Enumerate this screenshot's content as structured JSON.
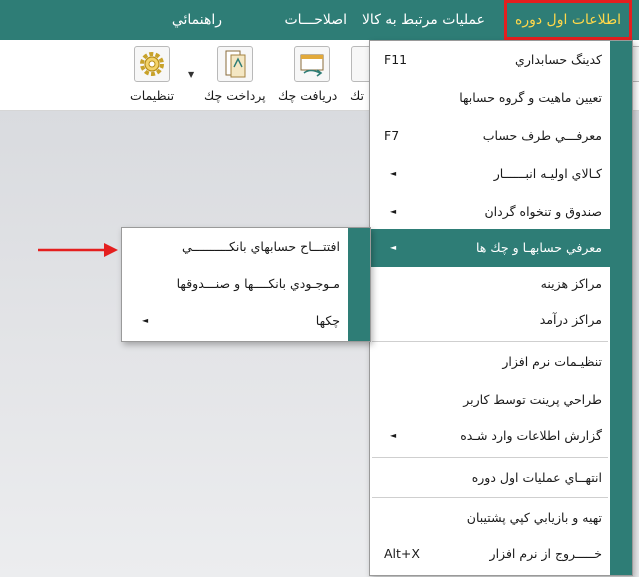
{
  "menubar": {
    "items": [
      {
        "label": "اطلاعات اول دوره",
        "active": true
      },
      {
        "label": "عمليات مرتبط به کالا"
      },
      {
        "label": "اصلاحـــات"
      },
      {
        "label": "راهنمائي"
      }
    ]
  },
  "toolbar": {
    "buttons": [
      {
        "label": "تنظيمات",
        "icon": "gear-icon"
      },
      {
        "label": "پرداخت چك",
        "icon": "check-payment-icon"
      },
      {
        "label": "دريافت چك",
        "icon": "check-receive-icon"
      },
      {
        "label": "تك",
        "icon": "partial-icon"
      }
    ]
  },
  "main_menu": {
    "items": [
      {
        "label": "كدينگ حسابداري",
        "shortcut": "F11"
      },
      {
        "label": "تعيين ماهيت و گروه حسابها"
      },
      {
        "label": "معرفـــي طرف حساب",
        "shortcut": "F7"
      },
      {
        "label": "كـالاي اوليـه انبــــــار"
      },
      {
        "label": "صندوق و تنخواه گردان"
      },
      {
        "label": "معرفي حسابهـا و چك ها"
      },
      {
        "label": "مراكز هزينه"
      },
      {
        "label": "مراكز درآمد"
      },
      {
        "label": "تنظيـمات نرم افزار"
      },
      {
        "label": "طراحي پرينت توسط كاربر"
      },
      {
        "label": "گزارش اطلاعات وارد شـده"
      },
      {
        "label": "انتهــاي عمليات اول دوره"
      },
      {
        "label": "تهيه و بازيابي كپي پشتيبان"
      },
      {
        "label": "خـــــروج از نرم افزار",
        "shortcut": "Alt+X"
      }
    ]
  },
  "sub_menu": {
    "items": [
      {
        "label": "افتتـــاح حسابهاي بانكــــــــــي"
      },
      {
        "label": "مـوجـودي بانكــــها و صنـــدوقها"
      },
      {
        "label": "چكها"
      }
    ]
  },
  "colors": {
    "accent": "#2e7d76",
    "active_menu_text": "#ffd84a",
    "highlight_border": "#e41f1f"
  }
}
